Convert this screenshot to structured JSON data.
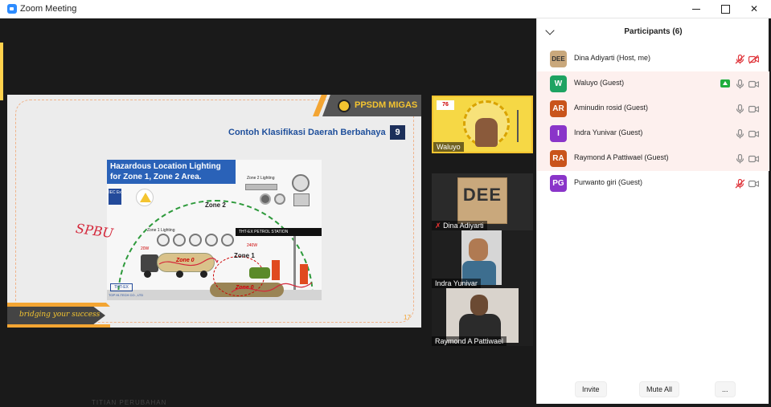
{
  "window": {
    "title": "Zoom Meeting"
  },
  "slide": {
    "banner": "PPSDM MIGAS",
    "heading": "Contoh Klasifikasi Daerah Berbahaya",
    "slide_box_number": "9",
    "figure": {
      "title_line1": "Hazardous Location Lighting",
      "title_line2": "for Zone 1, Zone 2 Area.",
      "zone2_label": "Zone 2",
      "zone2_lighting": "Zone 2 Lighting",
      "zone1_lighting": "Zone 1 Lighting",
      "zone1_label": "Zone 1",
      "zone0_tank_label": "Zone 0",
      "zone0_ug_label": "Zone 0",
      "station_sign": "THT-EX PETROL STATION",
      "watt_left": "20W",
      "watt_right": "240W",
      "cert_iec": "IEC Ex",
      "logo": "THT-EX",
      "logo_sub": "TOP HI-TECH CO., LTD"
    },
    "annotation": "SPBU",
    "footer_tagline": "bridging your success",
    "page_number": "17"
  },
  "stage": {
    "bottom_text": "TITIAN PERUBAHAN"
  },
  "video_tiles": [
    {
      "name": "Waluyo"
    },
    {
      "name": "Dina Adiyarti",
      "image_text": "DEE"
    },
    {
      "name": "Indra Yunivar"
    },
    {
      "name": "Raymond A Pattiwael"
    }
  ],
  "participants_panel": {
    "title": "Participants (6)",
    "participants": [
      {
        "initials": "DEE",
        "name": "Dina Adiyarti (Host, me)",
        "avatar_color": "#c9a87c",
        "mic": "muted",
        "video": "off"
      },
      {
        "initials": "W",
        "name": "Waluyo (Guest)",
        "avatar_color": "#1ea362",
        "mic": "on",
        "video": "on",
        "sharing": true
      },
      {
        "initials": "AR",
        "name": "Aminudin rosid (Guest)",
        "avatar_color": "#c9541b",
        "mic": "on",
        "video": "on"
      },
      {
        "initials": "I",
        "name": "Indra Yunivar (Guest)",
        "avatar_color": "#8a35c9",
        "mic": "on",
        "video": "on"
      },
      {
        "initials": "RA",
        "name": "Raymond A Pattiwael (Guest)",
        "avatar_color": "#c9541b",
        "mic": "on",
        "video": "on"
      },
      {
        "initials": "PG",
        "name": "Purwanto giri (Guest)",
        "avatar_color": "#8a35c9",
        "mic": "muted",
        "video": "on"
      }
    ],
    "footer": {
      "invite": "Invite",
      "mute_all": "Mute All",
      "more": "..."
    }
  },
  "colors": {
    "muted_red": "#e0383e",
    "icon_gray": "#8a8a8a",
    "share_green": "#1fae3d",
    "accent_orange": "#f3a533"
  }
}
